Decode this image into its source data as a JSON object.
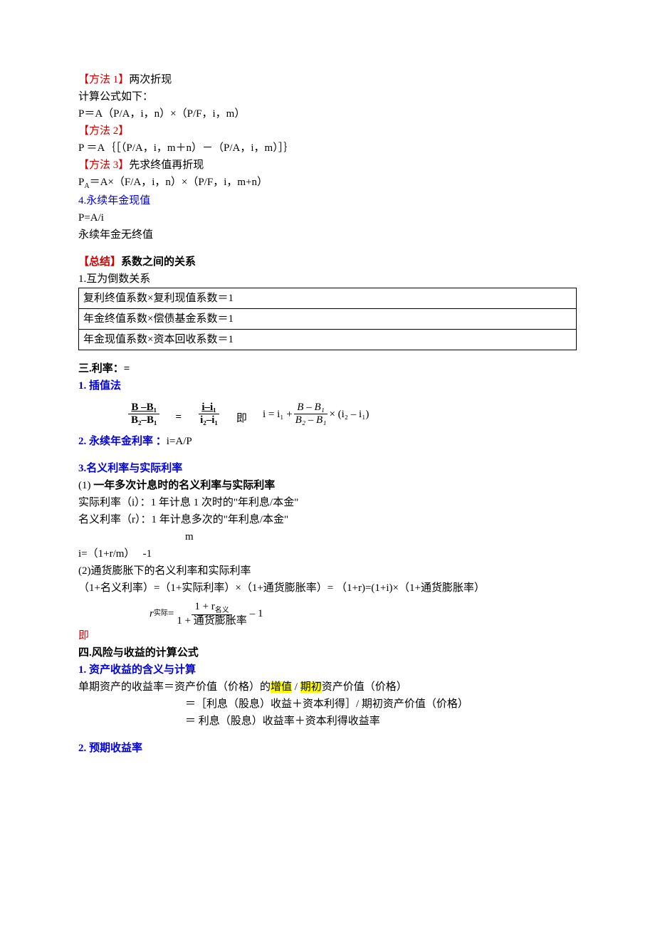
{
  "top": {
    "m1_label": "【方法 1】",
    "m1_text": "两次折现",
    "calc_label": "计算公式如下：",
    "formula1": "P＝A（P/A，i，n）×（P/F，i，m）",
    "m2_label": "【方法 2】",
    "formula2": "P ＝A｛［（P/A，i，m＋n）－（P/A，i，m）］｝",
    "m3_label": "【方法 3】",
    "m3_text": "先求终值再折现",
    "formula3_lhs": "P",
    "formula3_sub": "A",
    "formula3_rest": "＝A×（F/A，i，n）×（P/F，i，m+n）",
    "perp_title": "4.永续年金现值",
    "perp_formula": "P=A/i",
    "perp_note": "永续年金无终值"
  },
  "summary": {
    "heading_bracket": "【总结】",
    "heading_text": "系数之间的关系",
    "item1": "1.互为倒数关系",
    "row1": "复利终值系数×复利现值系数＝1",
    "row2": "年金终值系数×偿债基金系数＝1",
    "row3": "年金现值系数×资本回收系数＝1"
  },
  "rate": {
    "heading": "三.利率：=",
    "interp_title": "1. 插值法",
    "interp_left_num": "B –B₁",
    "interp_left_den": "B₂–B₁",
    "interp_right_num": "i–i₁",
    "interp_right_den": "i₂–i₁",
    "interp_eq": "=",
    "interp_ji": "即",
    "interp_result_pre": "i = i₁ + ",
    "interp_result_num": "B – B₁",
    "interp_result_den": "B₂ – B₁",
    "interp_result_post": " × (i₂ – i₁)",
    "perp_rate_title": "2. 永续年金利率 ：",
    "perp_rate_val": "i=A/P",
    "nominal_title": "3.名义利率与实际利率",
    "nominal_item1_pre": "(1) ",
    "nominal_item1": "一年多次计息时的名义利率与实际利率",
    "real_rate_def": "实际利率（i）：1 年计息 1 次时的\"年利息/本金\"",
    "nom_rate_def": "名义利率（r）：1 年计息多次的\"年利息/本金\"",
    "m_exp": "m",
    "conv_formula": "i=（1+r/m）   -1",
    "inflation_title": "(2)通货膨胀下的名义利率和实际利率",
    "inflation_line": "（1+名义利率）=（1+实际利率）×（1+通货膨胀率）= （1+r)=(1+i)×（1+通货膨胀率）",
    "inflation_r": "r",
    "inflation_r_sub": "实际",
    "inflation_eq": " = ",
    "inflation_num_pre": "1 + r",
    "inflation_num_sub": "名义",
    "inflation_den": "1 + 通货膨胀率",
    "inflation_post": " – 1",
    "ji": "即"
  },
  "risk": {
    "heading": "四.风险与收益的计算公式",
    "item1": "1. 资产收益的含义与计算",
    "line1_pre": "单期资产的收益率＝资产价值（价格）的",
    "line1_hl1": "增值",
    "line1_mid": " / ",
    "line1_hl2": "期初",
    "line1_post": "资产价值（价格）",
    "line2": "＝［利息（股息）收益＋资本利得］/ 期初资产价值（价格）",
    "line3": "＝ 利息（股息）收益率＋资本利得收益率",
    "item2": "2. 预期收益率"
  }
}
